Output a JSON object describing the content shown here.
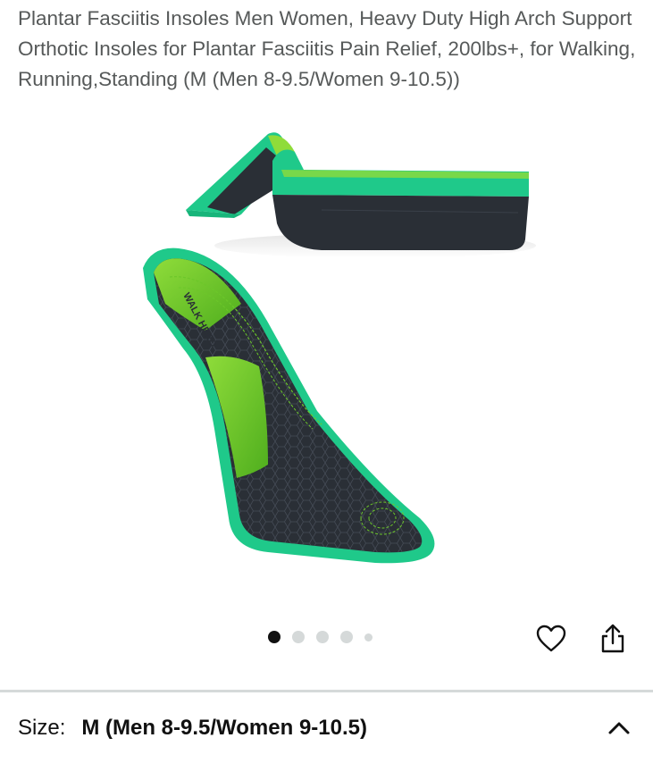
{
  "product": {
    "title": "Plantar Fasciitis Insoles Men Women, Heavy Duty High Arch Support Orthotic Insoles for Plantar Fasciitis Pain Relief, 200lbs+, for Walking, Running,Standing (M (Men 8-9.5/Women 9-10.5))",
    "image_logo_text": "WALK HERO"
  },
  "gallery": {
    "dot_count": 5,
    "active_index": 0
  },
  "actions": {
    "wishlist_icon": "heart-icon",
    "share_icon": "share-icon"
  },
  "size_selector": {
    "label": "Size:",
    "value": "M (Men 8-9.5/Women 9-10.5)",
    "toggle_icon": "chevron-up-icon"
  },
  "colors": {
    "insole_green": "#1fc98a",
    "insole_lime": "#6cc72a",
    "insole_dark": "#2a2f36"
  }
}
